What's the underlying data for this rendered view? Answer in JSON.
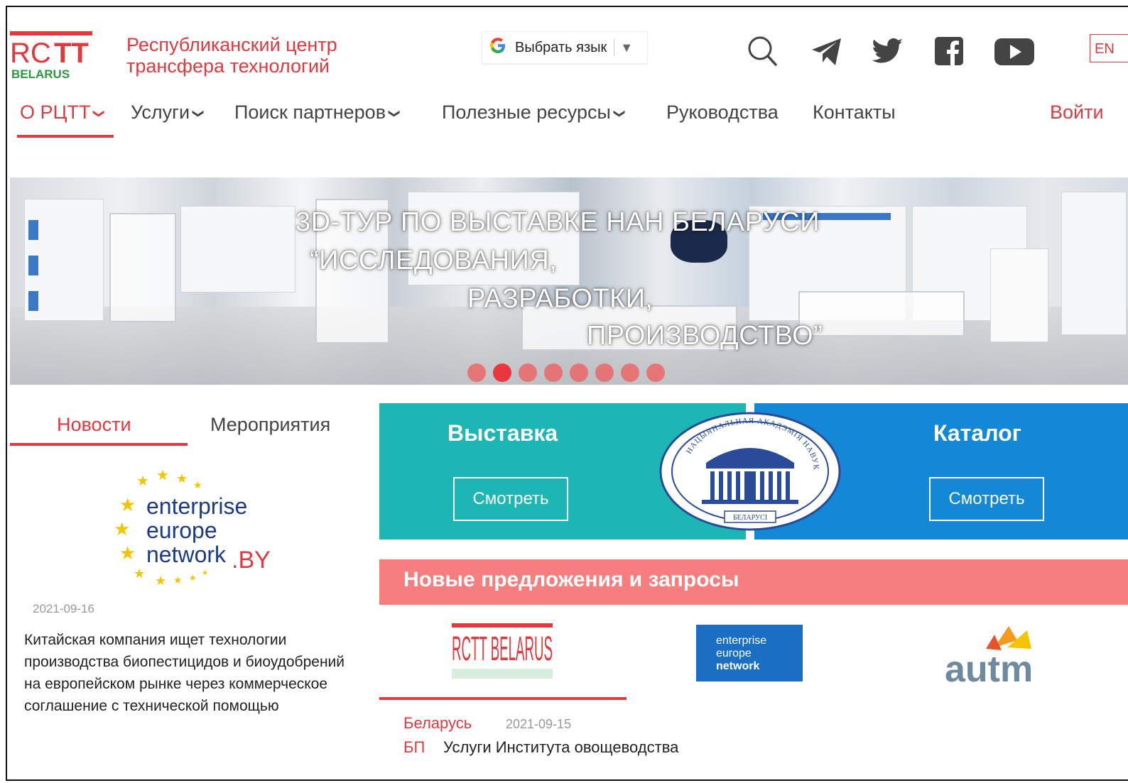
{
  "header": {
    "logo_top": "RC",
    "logo_tt": "TT",
    "logo_bottom": "BELARUS",
    "brand_line1": "Республиканский центр",
    "brand_line2": "трансфера технологий",
    "language_button": "Выбрать язык",
    "language_code": "EN"
  },
  "nav": {
    "items": [
      {
        "label": "О РЦТТ",
        "has_dropdown": true,
        "active": true
      },
      {
        "label": "Услуги",
        "has_dropdown": true
      },
      {
        "label": "Поиск партнеров",
        "has_dropdown": true
      },
      {
        "label": "Полезные ресурсы",
        "has_dropdown": true
      },
      {
        "label": "Руководства",
        "has_dropdown": false
      },
      {
        "label": "Контакты",
        "has_dropdown": false
      }
    ],
    "login": "Войти"
  },
  "banner": {
    "line1": "3D-ТУР ПО ВЫСТАВКЕ НАН БЕЛАРУСИ",
    "line2": "“ИССЛЕДОВАНИЯ,",
    "line3": "РАЗРАБОТКИ,",
    "line4": "ПРОИЗВОДСТВО”",
    "slide_count": 8,
    "active_slide": 2
  },
  "tabs": {
    "news": "Новости",
    "events": "Мероприятия"
  },
  "news_logo": {
    "line1": "enterprise",
    "line2": "europe",
    "line3": "network",
    "suffix": ".BY"
  },
  "news": {
    "date": "2021-09-16",
    "text": "Китайская компания ищет технологии производства биопестицидов и биоудобрений на европейском рынке через коммерческое соглашение с технической помощью"
  },
  "exhibition": {
    "title": "Выставка",
    "button": "Смотреть"
  },
  "seal": {
    "top_text": "НАЦЫЯНАЛЬНАЯ АКАДЭМІЯ НАВУК",
    "bottom_text": "БЕЛАРУСІ"
  },
  "catalog": {
    "title": "Каталог",
    "button": "Смотреть"
  },
  "offers": {
    "heading": "Новые предложения и запросы",
    "sources": [
      {
        "name": "RCTT BELARUS"
      },
      {
        "line1": "enterprise",
        "line2": "europe",
        "line3": "network"
      },
      {
        "name": "autm"
      }
    ],
    "item": {
      "country": "Беларусь",
      "date": "2021-09-15",
      "type": "БП",
      "title": "Услуги Института овощеводства"
    }
  },
  "colors": {
    "accent": "#e03a3e",
    "teal": "#1cb7b4",
    "blue": "#1288d6",
    "offers_bar": "#f77e7e",
    "logo_green": "#2a9a3c"
  },
  "icons": [
    "search-icon",
    "telegram-icon",
    "twitter-icon",
    "facebook-icon",
    "youtube-icon",
    "google-icon",
    "chevron-down-icon"
  ]
}
